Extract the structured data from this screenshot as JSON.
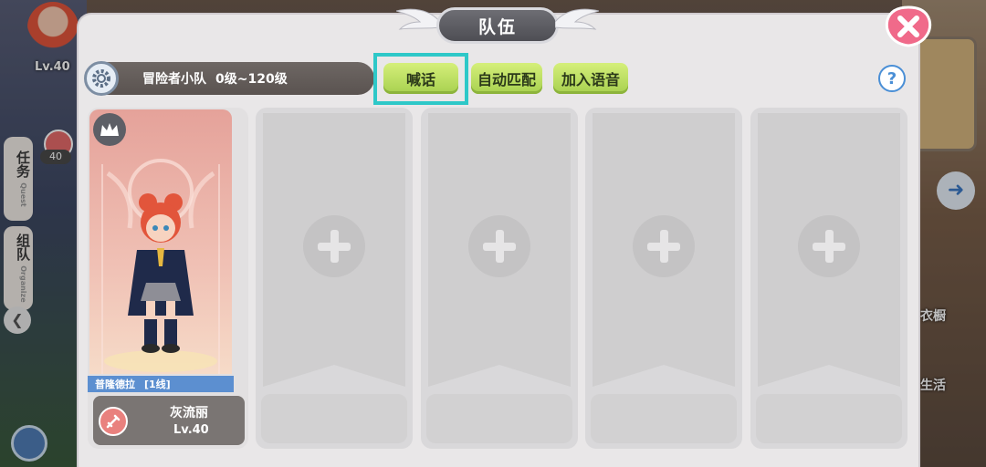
{
  "background": {
    "top_level": "Lv.40",
    "side_badge": "40",
    "side_buttons": [
      {
        "label": "任务",
        "sub": "Quest"
      },
      {
        "label": "组队",
        "sub": "Organize"
      }
    ],
    "right_labels": [
      "衣橱",
      "生活"
    ]
  },
  "panel": {
    "title": "队伍",
    "team_name": "冒险者小队",
    "level_range": "0级~120级",
    "buttons": {
      "shout": "喊话",
      "auto_match": "自动匹配",
      "join_voice": "加入语音"
    },
    "help": "?"
  },
  "member": {
    "server": "普隆德拉",
    "line": "[1线]",
    "name": "灰流丽",
    "level": "Lv.40"
  },
  "colors": {
    "highlight": "#2ec8c8",
    "button_green": "#b7dd5d",
    "close_pink": "#f06a8a"
  }
}
